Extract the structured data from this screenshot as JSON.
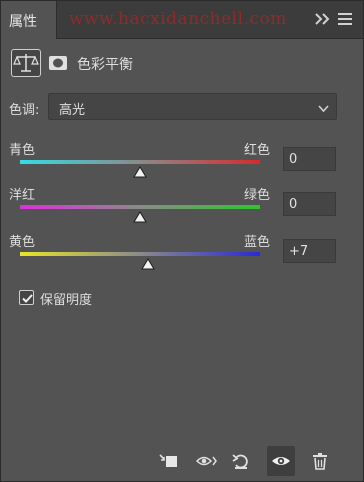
{
  "panel": {
    "tab_label": "属性",
    "watermark": "www.hacxidanchell.com",
    "type_title": "色彩平衡"
  },
  "tone": {
    "label": "色调:",
    "value": "高光"
  },
  "sliders": [
    {
      "left": "青色",
      "right": "红色",
      "value": "0",
      "level": 0,
      "colors": [
        "#33dde6",
        "#d92a2a"
      ]
    },
    {
      "left": "洋红",
      "right": "绿色",
      "value": "0",
      "level": 0,
      "colors": [
        "#dd30dd",
        "#2ac82a"
      ]
    },
    {
      "left": "黄色",
      "right": "蓝色",
      "value": "+7",
      "level": 7,
      "colors": [
        "#e8e626",
        "#2a2ad8"
      ]
    }
  ],
  "preserve": {
    "label": "保留明度",
    "checked": true
  },
  "toolbar_icons": [
    "clip-to-layer-icon",
    "view-previous-state-icon",
    "reset-icon",
    "visibility-icon",
    "delete-icon"
  ]
}
